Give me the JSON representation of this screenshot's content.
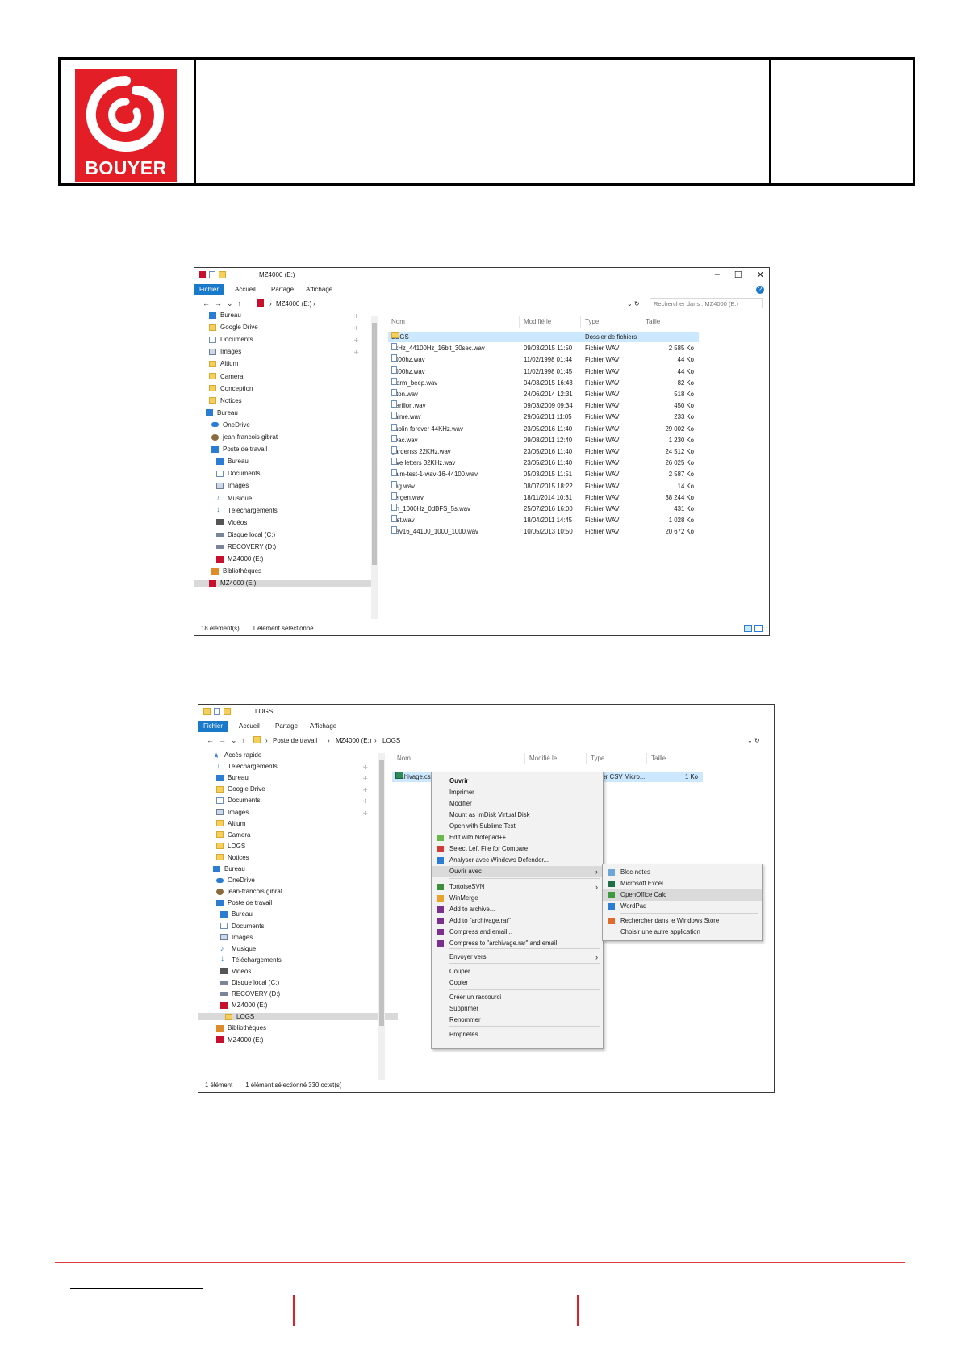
{
  "brand": {
    "name": "BOUYER",
    "color": "#e41e26"
  },
  "window1": {
    "title": "MZ4000 (E:)",
    "ribbon_tabs": [
      "Fichier",
      "Accueil",
      "Partage",
      "Affichage"
    ],
    "address": [
      "MZ4000 (E:)"
    ],
    "search_placeholder": "Rechercher dans : MZ4000 (E:)",
    "sidebar": [
      {
        "label": "Bureau",
        "icon": "desktop-icon",
        "pinned": true
      },
      {
        "label": "Google Drive",
        "icon": "folder-icon",
        "pinned": true
      },
      {
        "label": "Documents",
        "icon": "documents-icon",
        "pinned": true
      },
      {
        "label": "Images",
        "icon": "images-icon",
        "pinned": true
      },
      {
        "label": "Altium",
        "icon": "folder-icon"
      },
      {
        "label": "Camera",
        "icon": "folder-icon"
      },
      {
        "label": "Conception",
        "icon": "folder-icon"
      },
      {
        "label": "Notices",
        "icon": "folder-icon"
      },
      {
        "label": "Bureau",
        "icon": "desktop-icon"
      },
      {
        "label": "OneDrive",
        "icon": "onedrive-icon"
      },
      {
        "label": "jean-francois gibrat",
        "icon": "user-icon"
      },
      {
        "label": "Poste de travail",
        "icon": "computer-icon"
      },
      {
        "label": "Bureau",
        "icon": "desktop-icon"
      },
      {
        "label": "Documents",
        "icon": "documents-icon"
      },
      {
        "label": "Images",
        "icon": "images-icon"
      },
      {
        "label": "Musique",
        "icon": "music-icon"
      },
      {
        "label": "Téléchargements",
        "icon": "download-icon"
      },
      {
        "label": "Vidéos",
        "icon": "video-icon"
      },
      {
        "label": "Disque local (C:)",
        "icon": "drive-icon"
      },
      {
        "label": "RECOVERY (D:)",
        "icon": "drive-icon"
      },
      {
        "label": "MZ4000 (E:)",
        "icon": "sd-card-icon"
      },
      {
        "label": "Bibliothèques",
        "icon": "library-icon"
      },
      {
        "label": "MZ4000 (E:)",
        "icon": "sd-card-icon",
        "selected": true
      }
    ],
    "columns": [
      "Nom",
      "Modifié le",
      "Type",
      "Taille"
    ],
    "files": [
      [
        "LOGS",
        "",
        "Dossier de fichiers",
        ""
      ],
      [
        "1kHz_44100Hz_16bit_30sec.wav",
        "09/03/2015 11:50",
        "Fichier WAV",
        "2 585 Ko"
      ],
      [
        "1000hz.wav",
        "11/02/1998 01:44",
        "Fichier WAV",
        "44 Ko"
      ],
      [
        "2000hz.wav",
        "11/02/1998 01:45",
        "Fichier WAV",
        "44 Ko"
      ],
      [
        "alarm_beep.wav",
        "04/03/2015 16:43",
        "Fichier WAV",
        "82 Ko"
      ],
      [
        "biton.wav",
        "24/06/2014 12:31",
        "Fichier WAV",
        "518 Ko"
      ],
      [
        "Carillon.wav",
        "09/03/2009 09:34",
        "Fichier WAV",
        "450 Ko"
      ],
      [
        "chime.wav",
        "29/06/2011 11:05",
        "Fichier WAV",
        "233 Ko"
      ],
      [
        "dublin forever 44KHz.wav",
        "23/05/2016 11:40",
        "Fichier WAV",
        "29 002 Ko"
      ],
      [
        "evac.wav",
        "09/08/2011 12:40",
        "Fichier WAV",
        "1 230 Ko"
      ],
      [
        "gardenss 22KHz.wav",
        "23/05/2016 11:40",
        "Fichier WAV",
        "24 512 Ko"
      ],
      [
        "love letters 32KHz.wav",
        "23/05/2016 11:40",
        "Fichier WAV",
        "26 025 Ko"
      ],
      [
        "naim-test-1-wav-16-44100.wav",
        "05/03/2015 11:51",
        "Fichier WAV",
        "2 587 Ko"
      ],
      [
        "ring.wav",
        "08/07/2015 18:22",
        "Fichier WAV",
        "14 Ko"
      ],
      [
        "sergen.wav",
        "18/11/2014 10:31",
        "Fichier WAV",
        "38 244 Ko"
      ],
      [
        "sin_1000Hz_0dBFS_5s.wav",
        "25/07/2016 16:00",
        "Fichier WAV",
        "431 Ko"
      ],
      [
        "test.wav",
        "18/04/2011 14:45",
        "Fichier WAV",
        "1 028 Ko"
      ],
      [
        "wav16_44100_1000_1000.wav",
        "10/05/2013 10:50",
        "Fichier WAV",
        "20 672 Ko"
      ]
    ],
    "status": [
      "18 élément(s)",
      "1 élément sélectionné"
    ]
  },
  "window2": {
    "title": "LOGS",
    "ribbon_tabs": [
      "Fichier",
      "Accueil",
      "Partage",
      "Affichage"
    ],
    "address": [
      "Poste de travail",
      "MZ4000 (E:)",
      "LOGS"
    ],
    "sidebar": [
      {
        "label": "Accès rapide",
        "icon": "star-icon"
      },
      {
        "label": "Téléchargements",
        "icon": "download-icon",
        "pinned": true
      },
      {
        "label": "Bureau",
        "icon": "desktop-icon",
        "pinned": true
      },
      {
        "label": "Google Drive",
        "icon": "folder-icon",
        "pinned": true
      },
      {
        "label": "Documents",
        "icon": "documents-icon",
        "pinned": true
      },
      {
        "label": "Images",
        "icon": "images-icon",
        "pinned": true
      },
      {
        "label": "Altium",
        "icon": "folder-icon"
      },
      {
        "label": "Camera",
        "icon": "folder-icon"
      },
      {
        "label": "LOGS",
        "icon": "folder-icon"
      },
      {
        "label": "Notices",
        "icon": "folder-icon"
      },
      {
        "label": "Bureau",
        "icon": "desktop-icon"
      },
      {
        "label": "OneDrive",
        "icon": "onedrive-icon"
      },
      {
        "label": "jean-francois gibrat",
        "icon": "user-icon"
      },
      {
        "label": "Poste de travail",
        "icon": "computer-icon"
      },
      {
        "label": "Bureau",
        "icon": "desktop-icon"
      },
      {
        "label": "Documents",
        "icon": "documents-icon"
      },
      {
        "label": "Images",
        "icon": "images-icon"
      },
      {
        "label": "Musique",
        "icon": "music-icon"
      },
      {
        "label": "Téléchargements",
        "icon": "download-icon"
      },
      {
        "label": "Vidéos",
        "icon": "video-icon"
      },
      {
        "label": "Disque local (C:)",
        "icon": "drive-icon"
      },
      {
        "label": "RECOVERY (D:)",
        "icon": "drive-icon"
      },
      {
        "label": "MZ4000 (E:)",
        "icon": "sd-card-icon"
      },
      {
        "label": "LOGS",
        "icon": "folder-icon",
        "selected": true
      },
      {
        "label": "Bibliothèques",
        "icon": "library-icon"
      },
      {
        "label": "MZ4000 (E:)",
        "icon": "sd-card-icon"
      }
    ],
    "columns": [
      "Nom",
      "Modifié le",
      "Type",
      "Taille"
    ],
    "files": [
      [
        "archivage.csv",
        "",
        "Fichier CSV Micro...",
        "1 Ko"
      ]
    ],
    "status": [
      "1 élément",
      "1 élément sélectionné  330 octet(s)"
    ],
    "context_menu": [
      {
        "label": "Ouvrir",
        "bold": true
      },
      {
        "label": "Imprimer"
      },
      {
        "label": "Modifier"
      },
      {
        "label": "Mount as ImDisk Virtual Disk"
      },
      {
        "label": "Open with Sublime Text"
      },
      {
        "label": "Edit with Notepad++",
        "icon": "notepadpp-icon"
      },
      {
        "label": "Select Left File for Compare",
        "icon": "compare-icon"
      },
      {
        "label": "Analyser avec Windows Defender...",
        "icon": "defender-icon"
      },
      {
        "label": "Ouvrir avec",
        "submenu": true,
        "highlight": true
      },
      {
        "label": "TortoiseSVN",
        "icon": "tortoise-icon",
        "submenu": true
      },
      {
        "label": "WinMerge",
        "icon": "winmerge-icon"
      },
      {
        "label": "Add to archive...",
        "icon": "winrar-icon"
      },
      {
        "label": "Add to \"archivage.rar\"",
        "icon": "winrar-icon"
      },
      {
        "label": "Compress and email...",
        "icon": "winrar-icon"
      },
      {
        "label": "Compress to \"archivage.rar\" and email",
        "icon": "winrar-icon"
      },
      {
        "label": "Envoyer vers",
        "submenu": true
      },
      {
        "label": "Couper"
      },
      {
        "label": "Copier"
      },
      {
        "label": "Créer un raccourci"
      },
      {
        "label": "Supprimer"
      },
      {
        "label": "Renommer"
      },
      {
        "label": "Propriétés"
      }
    ],
    "submenu": [
      {
        "label": "Bloc-notes",
        "icon": "notepad-icon"
      },
      {
        "label": "Microsoft Excel",
        "icon": "excel-icon"
      },
      {
        "label": "OpenOffice Calc",
        "icon": "openoffice-calc-icon",
        "highlight": true
      },
      {
        "label": "WordPad",
        "icon": "wordpad-icon"
      },
      {
        "label": "Rechercher dans le Windows Store",
        "icon": "store-icon"
      },
      {
        "label": "Choisir une autre application"
      }
    ]
  }
}
